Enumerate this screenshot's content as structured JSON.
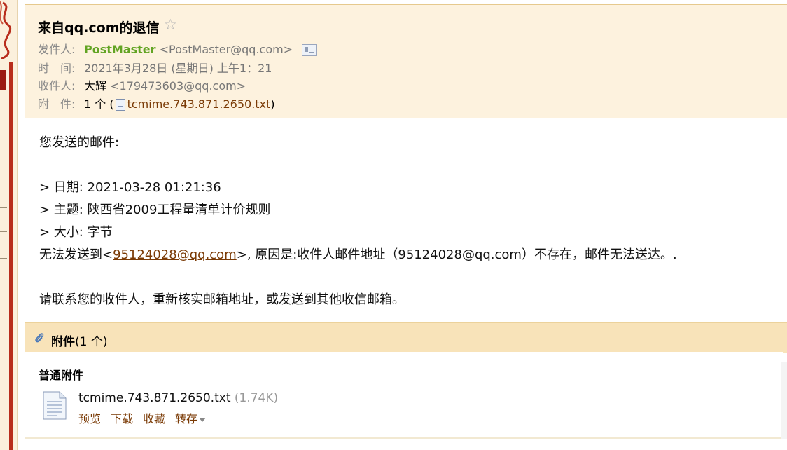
{
  "header": {
    "subject": "来自qq.com的退信",
    "from_label": "发件人:",
    "from_name": "PostMaster",
    "from_email": "<PostMaster@qq.com>",
    "time_label": "时　间:",
    "time_value": "2021年3月28日 (星期日) 上午1：21",
    "to_label": "收件人:",
    "to_name": "大辉",
    "to_email": "<179473603@qq.com>",
    "attach_label": "附　件:",
    "attach_count": "1 个 (",
    "attach_file": "tcmime.743.871.2650.txt",
    "attach_close": ")"
  },
  "body": {
    "line1": "您发送的邮件:",
    "line_date": "> 日期: 2021-03-28 01:21:36",
    "line_subject": "> 主题: 陕西省2009工程量清单计价规则",
    "line_size": "> 大小: 字节",
    "fail_prefix": "无法发送到<",
    "fail_email": "95124028@qq.com",
    "fail_suffix": ">, 原因是:收件人邮件地址（95124028@qq.com）不存在，邮件无法送达。.",
    "line_contact": "请联系您的收件人，重新核实邮箱地址，或发送到其他收信邮箱。"
  },
  "attachments": {
    "title": "附件",
    "count": "(1 个)",
    "section": "普通附件",
    "file_name": "tcmime.743.871.2650.txt",
    "file_size": "(1.74K)",
    "actions": {
      "preview": "预览",
      "download": "下载",
      "favorite": "收藏",
      "save_to": "转存"
    }
  }
}
